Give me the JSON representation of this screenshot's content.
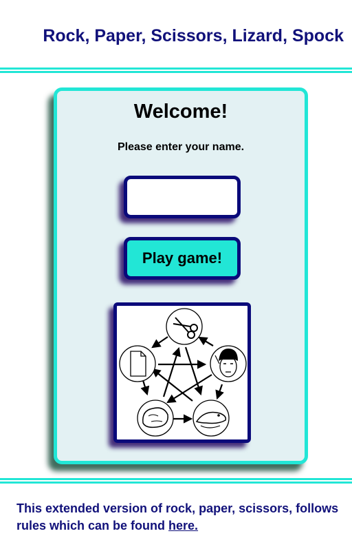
{
  "header": {
    "title": "Rock, Paper, Scissors, Lizard, Spock"
  },
  "card": {
    "heading": "Welcome!",
    "prompt": "Please enter your name.",
    "name_input": {
      "value": "",
      "placeholder": ""
    },
    "play_button_label": "Play game!"
  },
  "diagram": {
    "items": [
      "scissors",
      "spock",
      "lizard",
      "rock",
      "paper"
    ]
  },
  "footer": {
    "text": "This extended version of rock, paper, scissors, follows rules which can be found ",
    "link_text": "here."
  },
  "colors": {
    "accent": "#22e6d6",
    "navy": "#11117a",
    "card_bg": "#e3f1f3",
    "border_dark": "#0a0a7a"
  }
}
